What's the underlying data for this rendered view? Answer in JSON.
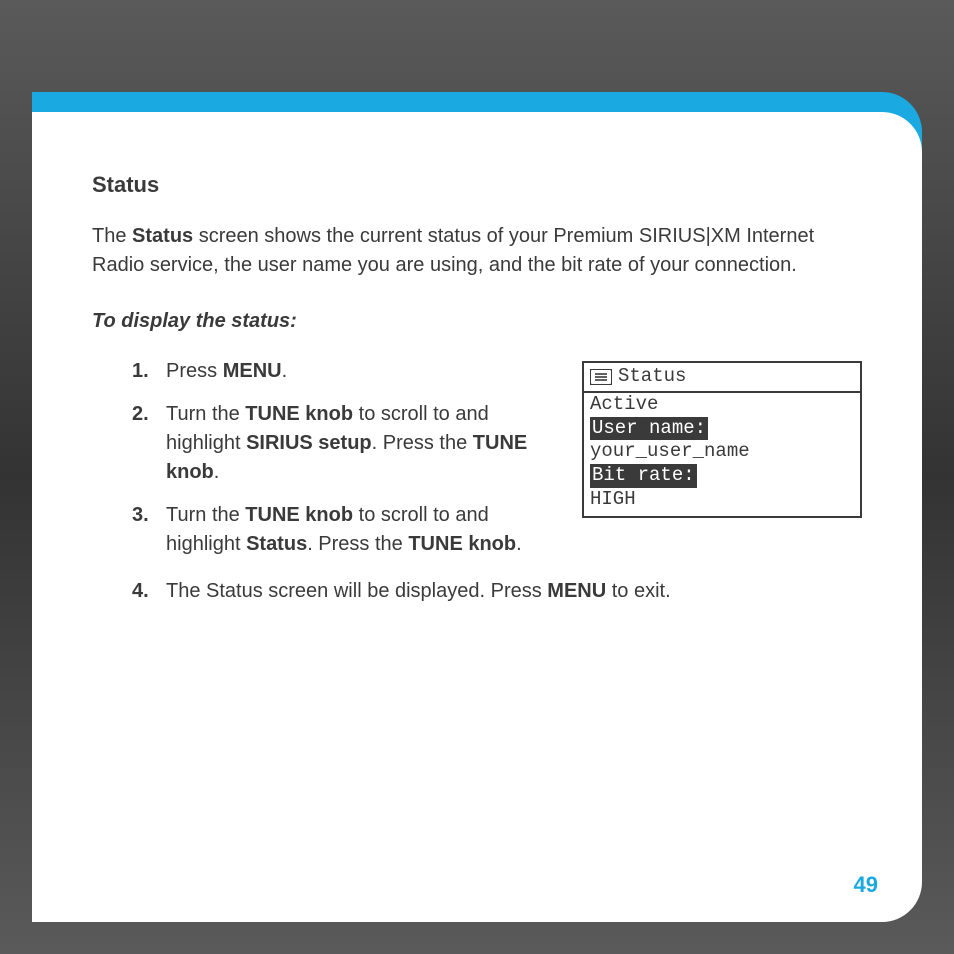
{
  "page_number": "49",
  "section_title": "Status",
  "intro_parts": {
    "p1": "The ",
    "b1": "Status",
    "p2": " screen shows the current status of your Premium SIRIUS|XM Internet Radio service, the user name you are using, and the bit rate of your connection."
  },
  "sub_heading": "To display the status:",
  "steps": {
    "s1": {
      "t1": "Press ",
      "b1": "MENU",
      "t2": "."
    },
    "s2": {
      "t1": "Turn the ",
      "b1": "TUNE knob",
      "t2": " to scroll to and highlight ",
      "b2": "SIRIUS setup",
      "t3": ". Press the ",
      "b3": "TUNE knob",
      "t4": "."
    },
    "s3": {
      "t1": "Turn the ",
      "b1": "TUNE knob",
      "t2": " to scroll to and highlight ",
      "b2": "Status",
      "t3": ". Press the ",
      "b3": "TUNE knob",
      "t4": "."
    },
    "s4": {
      "t1": "The Status screen will be displayed. Press ",
      "b1": "MENU",
      "t2": " to exit."
    }
  },
  "lcd": {
    "title": "Status",
    "rows": {
      "r1": "Active",
      "r2_label": "User name:",
      "r3": "your_user_name",
      "r4_label": "Bit rate:",
      "r5": "HIGH"
    }
  }
}
